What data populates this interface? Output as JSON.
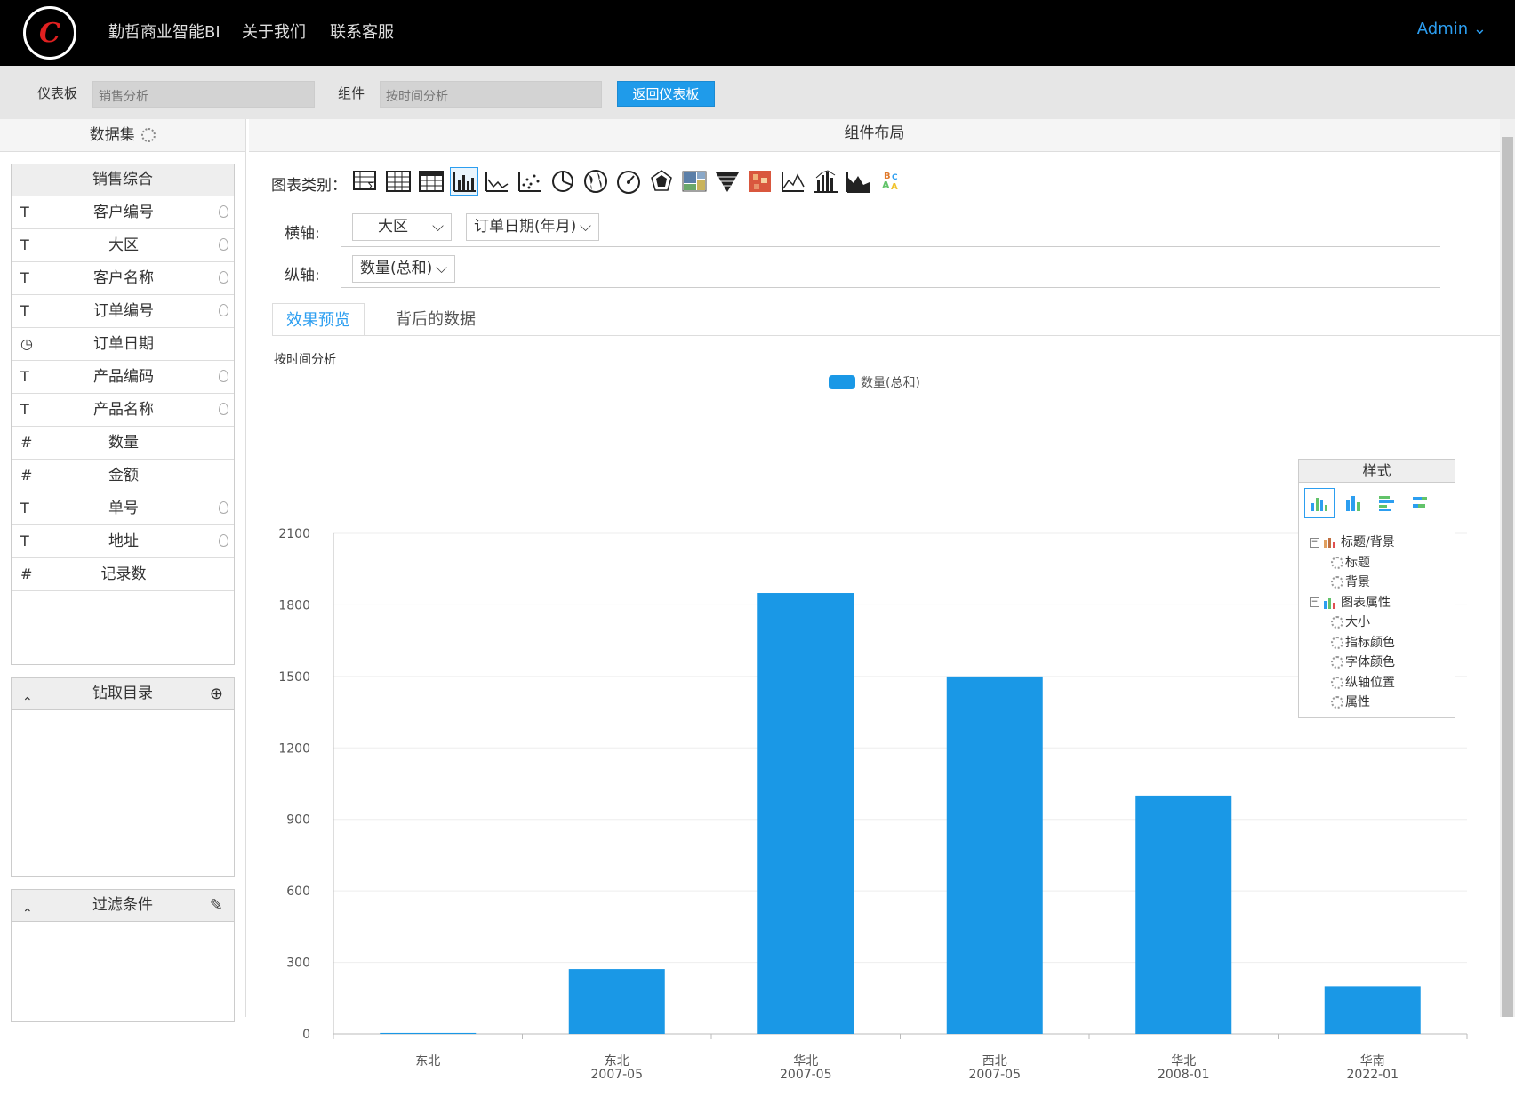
{
  "nav": {
    "logo_text": "C",
    "items": [
      "勤哲商业智能BI",
      "关于我们",
      "联系客服"
    ],
    "user": "Admin",
    "user_caret": "⌄"
  },
  "toolbar": {
    "dashboard_label": "仪表板",
    "dashboard_value": "销售分析",
    "component_label": "组件",
    "component_value": "按时间分析",
    "back_button": "返回仪表板"
  },
  "dataset": {
    "title": "数据集",
    "group_title": "销售综合",
    "fields": [
      {
        "type": "T",
        "name": "客户编号",
        "pin": true
      },
      {
        "type": "T",
        "name": "大区",
        "pin": true
      },
      {
        "type": "T",
        "name": "客户名称",
        "pin": true
      },
      {
        "type": "T",
        "name": "订单编号",
        "pin": true
      },
      {
        "type": "◷",
        "name": "订单日期",
        "pin": false
      },
      {
        "type": "T",
        "name": "产品编码",
        "pin": true
      },
      {
        "type": "T",
        "name": "产品名称",
        "pin": true
      },
      {
        "type": "#",
        "name": "数量",
        "pin": false
      },
      {
        "type": "#",
        "name": "金额",
        "pin": false
      },
      {
        "type": "T",
        "name": "单号",
        "pin": true
      },
      {
        "type": "T",
        "name": "地址",
        "pin": true
      },
      {
        "type": "#",
        "name": "记录数",
        "pin": false
      }
    ]
  },
  "drill": {
    "title": "钻取目录",
    "collapse": "⌃",
    "add": "⊕"
  },
  "filter": {
    "title": "过滤条件",
    "collapse": "⌃",
    "edit": "✎"
  },
  "main": {
    "title": "组件布局",
    "chart_type_label": "图表类别：",
    "x_axis_label": "横轴:",
    "x_axis_fields": [
      "大区",
      "订单日期(年月)"
    ],
    "y_axis_label": "纵轴:",
    "y_axis_fields": [
      "数量(总和)"
    ],
    "caret": "⌵",
    "tabs": [
      "效果预览",
      "背后的数据"
    ],
    "chart_title": "按时间分析"
  },
  "style_panel": {
    "title": "样式",
    "tree": [
      {
        "label": "标题/背景",
        "children": [
          "标题",
          "背景"
        ]
      },
      {
        "label": "图表属性",
        "children": [
          "大小",
          "指标颜色",
          "字体颜色",
          "纵轴位置",
          "属性"
        ]
      }
    ]
  },
  "colors": {
    "accent": "#1a98e6",
    "nav_bg": "#000000",
    "link": "#2c9ef0"
  },
  "chart_data": {
    "type": "bar",
    "categories": [
      "东北",
      "东北\n2007-05",
      "华北\n2007-05",
      "西北\n2007-05",
      "华北\n2008-01",
      "华南\n2022-01"
    ],
    "series": [
      {
        "name": "数量(总和)",
        "values": [
          4,
          272,
          1850,
          1500,
          1000,
          200
        ]
      }
    ],
    "ylim": [
      0,
      2100
    ],
    "yticks": [
      0,
      300,
      600,
      900,
      1200,
      1500,
      1800,
      2100
    ],
    "title": "按时间分析",
    "legend": "top-center",
    "grid": true,
    "color": "#1a98e6"
  }
}
